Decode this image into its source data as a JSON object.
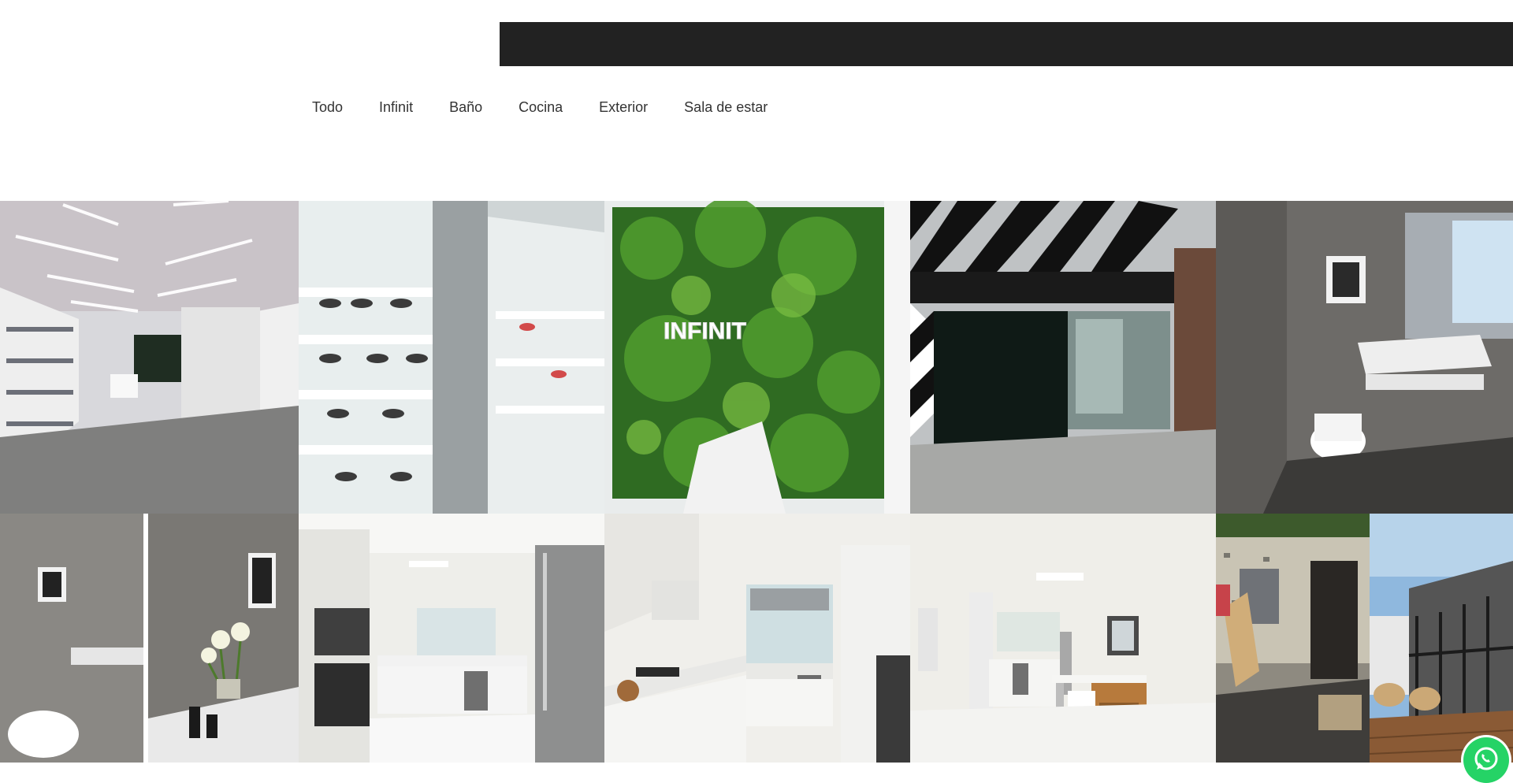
{
  "header": {
    "bar_color": "#222222"
  },
  "filters": {
    "items": [
      {
        "label": "Todo"
      },
      {
        "label": "Infinit"
      },
      {
        "label": "Baño"
      },
      {
        "label": "Cocina"
      },
      {
        "label": "Exterior"
      },
      {
        "label": "Sala de estar"
      }
    ]
  },
  "gallery": {
    "tiles": [
      {
        "subject": "infinit-store-interior-aisle"
      },
      {
        "subject": "infinit-store-sunglasses-shelves"
      },
      {
        "subject": "infinit-green-wall"
      },
      {
        "subject": "infinit-storefront"
      },
      {
        "subject": "bathroom-vanity"
      },
      {
        "subject": "bathroom-mirror-flowers"
      },
      {
        "subject": "kitchen-fridge-oven"
      },
      {
        "subject": "kitchen-cooktop"
      },
      {
        "subject": "kitchen-dining-nook"
      },
      {
        "subject": "exterior-construction"
      },
      {
        "subject": "exterior-terrace"
      }
    ],
    "logo_text": "INFINIT"
  },
  "whatsapp": {
    "icon": "whatsapp-icon",
    "color": "#25d366"
  }
}
